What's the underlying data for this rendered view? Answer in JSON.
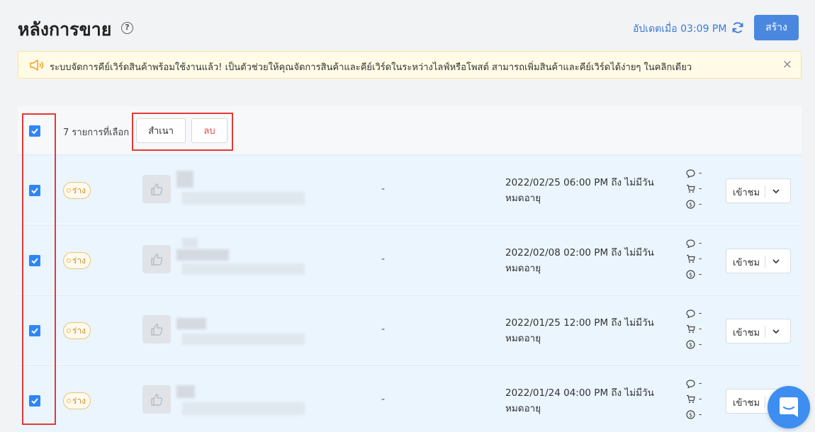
{
  "header": {
    "title": "หลังการขาย",
    "updated_text": "อัปเดตเมื่อ 03:09 PM",
    "create_label": "สร้าง"
  },
  "banner": {
    "message": "ระบบจัดการคีย์เวิร์ดสินค้าพร้อมใช้งานแล้ว! เป็นตัวช่วยให้คุณจัดการสินค้าและคีย์เวิร์ดในระหว่างไลฟ์หรือโพสต์ สามารถเพิ่มสินค้าและคีย์เวิร์ดได้ง่ายๆ ในคลิกเดียว",
    "close_glyph": "×"
  },
  "toolbar": {
    "selected_text": "7 รายการที่เลือก",
    "copy_label": "สำเนา",
    "delete_label": "ลบ"
  },
  "rows": [
    {
      "status": "ร่าง",
      "col_dash": "-",
      "period": "2022/02/25 06:00 PM ถึง ไม่มีวันหมดอายุ",
      "comments": "-",
      "cart": "-",
      "money": "-",
      "view_label": "เข้าชม"
    },
    {
      "status": "ร่าง",
      "col_dash": "-",
      "period": "2022/02/08 02:00 PM ถึง ไม่มีวันหมดอายุ",
      "comments": "-",
      "cart": "-",
      "money": "-",
      "view_label": "เข้าชม"
    },
    {
      "status": "ร่าง",
      "col_dash": "-",
      "period": "2022/01/25 12:00 PM ถึง ไม่มีวันหมดอายุ",
      "comments": "-",
      "cart": "-",
      "money": "-",
      "view_label": "เข้าชม"
    },
    {
      "status": "ร่าง",
      "col_dash": "-",
      "period": "2022/01/24 04:00 PM ถึง ไม่มีวันหมดอายุ",
      "comments": "-",
      "cart": "-",
      "money": "-",
      "view_label": "เข้าชม"
    }
  ],
  "colors": {
    "accent": "#4a88e0",
    "checkbox": "#2f86f6",
    "highlight_box": "#e53935",
    "row_bg": "#eaf5fd",
    "draft_badge": "#c8902c",
    "delete_text": "#e04848"
  },
  "icons": [
    "help-icon",
    "refresh-icon",
    "speaker-icon",
    "close-icon",
    "check-icon",
    "thumbs-up-icon",
    "comment-icon",
    "cart-icon",
    "dollar-icon",
    "chevron-down-icon",
    "chat-icon"
  ]
}
